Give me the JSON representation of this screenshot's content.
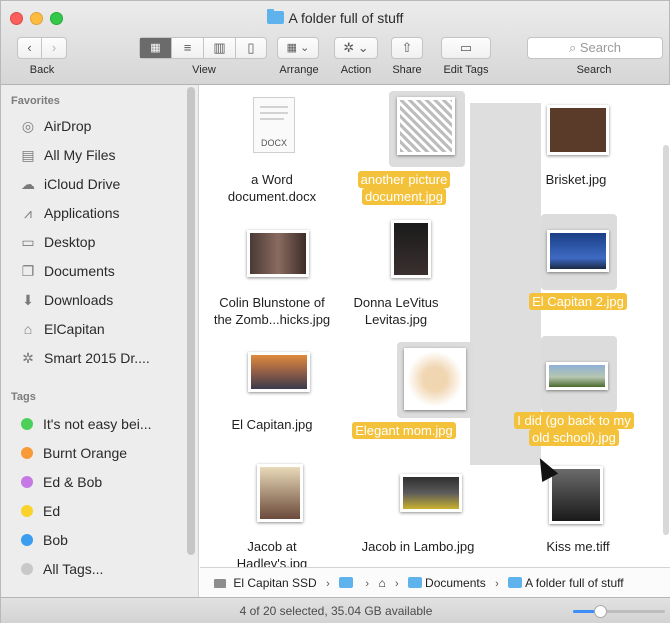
{
  "window": {
    "title": "A folder full of stuff"
  },
  "toolbar": {
    "back_prev": "‹",
    "back_next": "›",
    "back_label": "Back",
    "view_label": "View",
    "arrange_label": "Arrange",
    "action_label": "Action",
    "share_label": "Share",
    "edit_tags_label": "Edit Tags",
    "search_placeholder": "Search",
    "search_label": "Search"
  },
  "sidebar": {
    "favorites_header": "Favorites",
    "favorites": [
      {
        "label": "AirDrop",
        "icon": "airdrop-icon",
        "glyph": "◎"
      },
      {
        "label": "All My Files",
        "icon": "all-my-files-icon",
        "glyph": "▤"
      },
      {
        "label": "iCloud Drive",
        "icon": "icloud-icon",
        "glyph": "☁"
      },
      {
        "label": "Applications",
        "icon": "applications-icon",
        "glyph": "⩘"
      },
      {
        "label": "Desktop",
        "icon": "desktop-icon",
        "glyph": "▭"
      },
      {
        "label": "Documents",
        "icon": "documents-icon",
        "glyph": "❐"
      },
      {
        "label": "Downloads",
        "icon": "downloads-icon",
        "glyph": "⬇"
      },
      {
        "label": "ElCapitan",
        "icon": "home-icon",
        "glyph": "⌂"
      },
      {
        "label": "Smart 2015 Dr....",
        "icon": "smart-folder-icon",
        "glyph": "✲"
      }
    ],
    "tags_header": "Tags",
    "tags": [
      {
        "label": "It's not easy bei...",
        "color": "#4cd05a"
      },
      {
        "label": "Burnt Orange",
        "color": "#f99a39"
      },
      {
        "label": "Ed & Bob",
        "color": "#c678e5"
      },
      {
        "label": "Ed",
        "color": "#f9d22c"
      },
      {
        "label": "Bob",
        "color": "#3a9df0"
      },
      {
        "label": "All Tags...",
        "color": "#c8c8c8"
      }
    ]
  },
  "files": [
    {
      "name_line1": "a Word",
      "name_line2": "document.docx",
      "selected": false,
      "doc_tag": "DOCX"
    },
    {
      "name_line1": "another picture",
      "name_line2": "document.jpg",
      "selected": true
    },
    {
      "name_line1": "Brisket.jpg",
      "name_line2": "",
      "selected": false
    },
    {
      "name_line1": "Colin Blunstone of",
      "name_line2": "the Zomb...hicks.jpg",
      "selected": false
    },
    {
      "name_line1": "Donna LeVitus",
      "name_line2": "Levitas.jpg",
      "selected": false
    },
    {
      "name_line1": "El Capitan 2.jpg",
      "name_line2": "",
      "selected": true
    },
    {
      "name_line1": "El Capitan.jpg",
      "name_line2": "",
      "selected": false
    },
    {
      "name_line1": "Elegant mom.jpg",
      "name_line2": "",
      "selected": true
    },
    {
      "name_line1": "I did (go back to my",
      "name_line2": "old school).jpg",
      "selected": true
    },
    {
      "name_line1": "Jacob at",
      "name_line2": "Hadley's.jpg",
      "selected": false
    },
    {
      "name_line1": "Jacob in Lambo.jpg",
      "name_line2": "",
      "selected": false
    },
    {
      "name_line1": "Kiss me.tiff",
      "name_line2": "",
      "selected": false
    }
  ],
  "pathbar": {
    "disk": "El Capitan SSD",
    "documents": "Documents",
    "current": "A folder full of stuff"
  },
  "status": {
    "text": "4 of 20 selected, 35.04 GB available",
    "icon_size_fraction": 0.3
  },
  "colors": {
    "selection_highlight": "#f4c13a",
    "accent": "#3d8ef7",
    "folder": "#5fb3ec"
  }
}
